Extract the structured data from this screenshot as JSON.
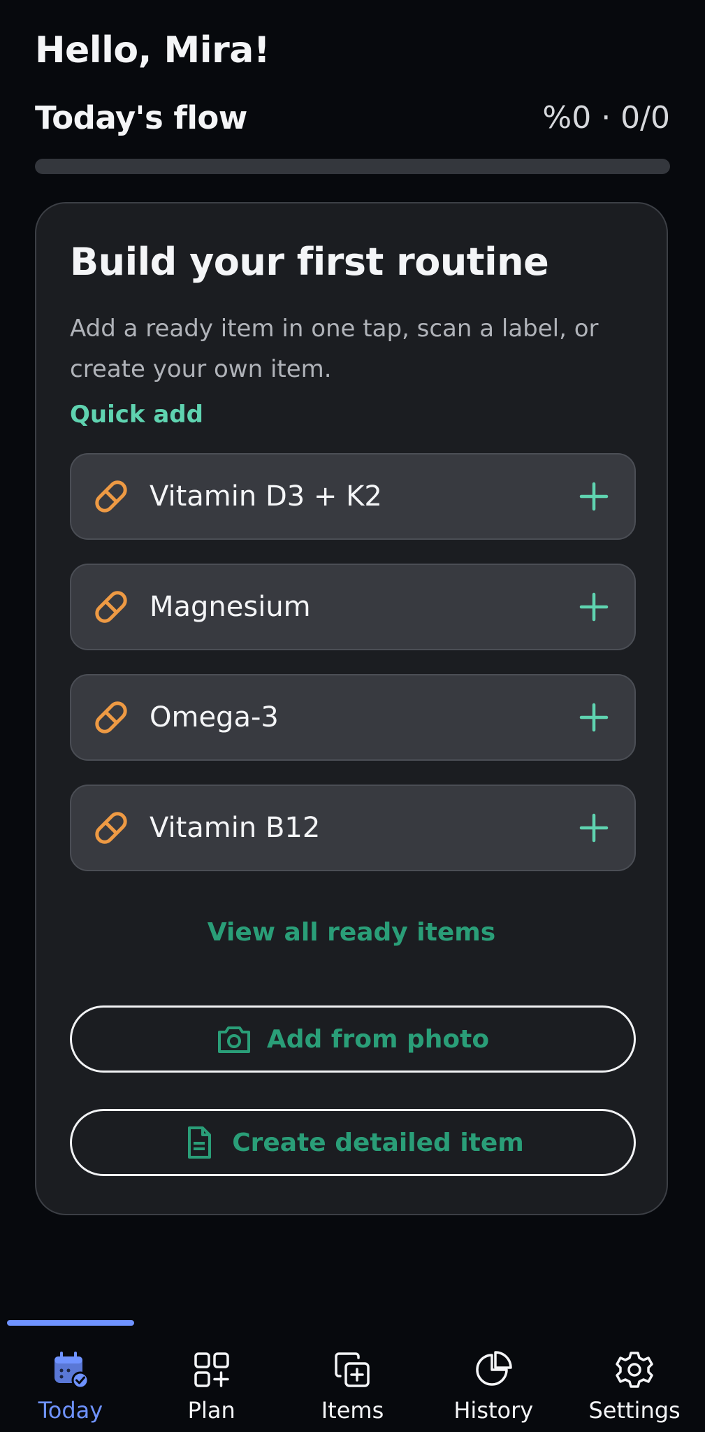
{
  "header": {
    "greeting": "Hello, Mira!",
    "flow_title": "Today's flow",
    "flow_stats": "%0 · 0/0",
    "progress_fraction": 0
  },
  "colors": {
    "accent_green": "#2a9e78",
    "accent_green_light": "#5fd3b0",
    "pill_orange": "#ee9a44",
    "nav_active": "#6f93ff"
  },
  "card": {
    "title": "Build your first routine",
    "description": "Add a ready item in one tap, scan a label, or create your own item.",
    "quick_add_label": "Quick add",
    "items": [
      {
        "label": "Vitamin D3 + K2",
        "icon": "pill-icon",
        "action_icon": "plus-icon"
      },
      {
        "label": "Magnesium",
        "icon": "pill-icon",
        "action_icon": "plus-icon"
      },
      {
        "label": "Omega-3",
        "icon": "pill-icon",
        "action_icon": "plus-icon"
      },
      {
        "label": "Vitamin B12",
        "icon": "pill-icon",
        "action_icon": "plus-icon"
      }
    ],
    "view_all_label": "View all ready items",
    "add_photo_label": "Add from photo",
    "create_item_label": "Create detailed item"
  },
  "nav": {
    "active": "Today",
    "items": [
      {
        "label": "Today",
        "icon": "calendar-check-icon"
      },
      {
        "label": "Plan",
        "icon": "grid-plus-icon"
      },
      {
        "label": "Items",
        "icon": "copy-plus-icon"
      },
      {
        "label": "History",
        "icon": "pie-chart-icon"
      },
      {
        "label": "Settings",
        "icon": "gear-icon"
      }
    ]
  }
}
